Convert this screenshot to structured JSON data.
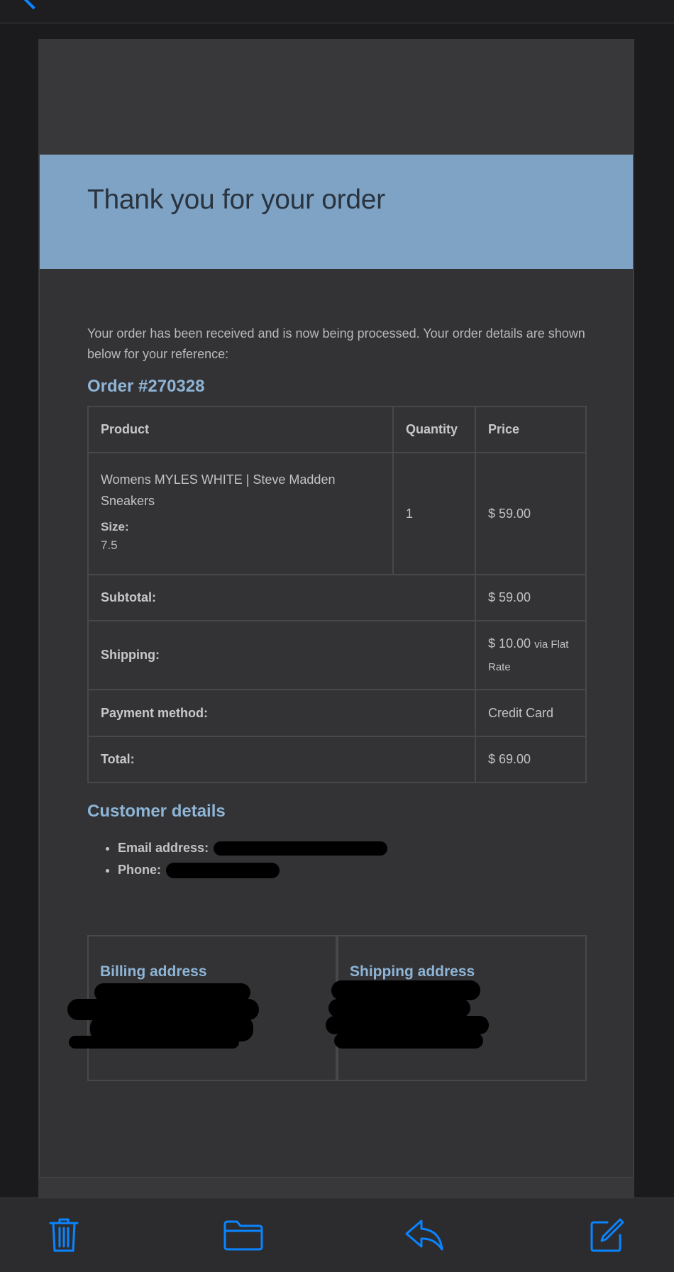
{
  "email": {
    "header_title": "Thank you for your order",
    "intro": "Your order has been received and is now being processed. Your order details are shown below for your reference:",
    "order_heading": "Order #270328",
    "table": {
      "columns": [
        "Product",
        "Quantity",
        "Price"
      ],
      "item": {
        "name": "Womens MYLES WHITE | Steve Madden Sneakers",
        "meta_label": "Size:",
        "meta_value": "7.5",
        "quantity": "1",
        "price": "$ 59.00"
      },
      "totals": [
        {
          "label": "Subtotal:",
          "value": "$ 59.00",
          "note": ""
        },
        {
          "label": "Shipping:",
          "value": "$ 10.00",
          "note": "via Flat Rate"
        },
        {
          "label": "Payment method:",
          "value": "Credit Card",
          "note": ""
        },
        {
          "label": "Total:",
          "value": "$ 69.00",
          "note": ""
        }
      ]
    },
    "customer_heading": "Customer details",
    "customer": {
      "email_label": "Email address:",
      "phone_label": "Phone:"
    },
    "billing_heading": "Billing address",
    "shipping_heading": "Shipping address"
  },
  "toolbar": {
    "icons": [
      "trash-icon",
      "folder-icon",
      "reply-icon",
      "compose-icon"
    ],
    "accent_color": "#0a84ff"
  },
  "colors": {
    "header_band": "#7fa3c4",
    "heading_accent": "#8eb4d6",
    "card_bg": "#333335"
  }
}
